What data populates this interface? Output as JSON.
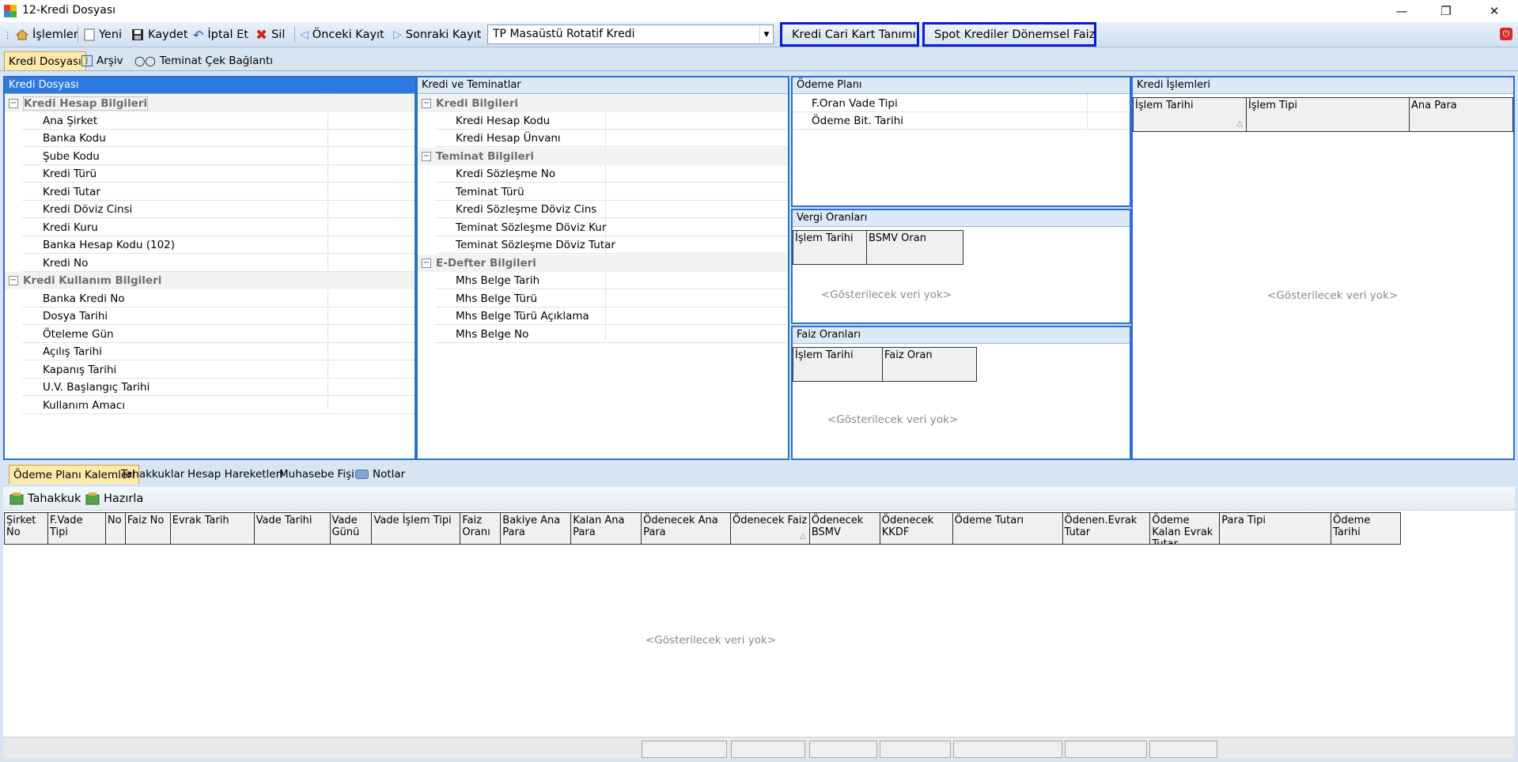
{
  "window": {
    "title": "12-Kredi Dosyası"
  },
  "toolbar": {
    "islemler": "İşlemler",
    "yeni": "Yeni",
    "kaydet": "Kaydet",
    "iptal": "İptal Et",
    "sil": "Sil",
    "onceki": "Önceki Kayıt",
    "sonraki": "Sonraki Kayıt",
    "combo_value": "TP Masaüstü Rotatif Kredi",
    "kredi_cari": "Kredi Cari Kart Tanımı",
    "spot": "Spot Krediler Dönemsel Faiz"
  },
  "tabs": [
    "Kredi Dosyası",
    "Arşiv",
    "Teminat Çek Bağlantı"
  ],
  "panels": {
    "kredi_dosyasi": {
      "title": "Kredi Dosyası",
      "group1": "Kredi Hesap Bilgileri",
      "group1_items": [
        "Ana Şirket",
        "Banka Kodu",
        "Şube Kodu",
        "Kredi Türü",
        "Kredi Tutar",
        "Kredi Döviz Cinsi",
        "Kredi Kuru",
        "Banka Hesap Kodu (102)",
        "Kredi No"
      ],
      "group2": "Kredi Kullanım Bilgileri",
      "group2_items": [
        "Banka Kredi No",
        "Dosya Tarihi",
        "Öteleme Gün",
        "Açılış Tarihi",
        "Kapanış Tarihi",
        "U.V. Başlangıç Tarihi",
        "Kullanım Amacı"
      ]
    },
    "kredi_teminat": {
      "title": "Kredi ve Teminatlar",
      "group1": "Kredi Bilgileri",
      "group1_items": [
        "Kredi Hesap Kodu",
        "Kredi Hesap Ünvanı"
      ],
      "group2": "Teminat Bilgileri",
      "group2_items": [
        "Kredi Sözleşme No",
        "Teminat Türü",
        "Kredi Sözleşme Döviz Cins",
        "Teminat Sözleşme Döviz Kur",
        "Teminat Sözleşme Döviz Tutar"
      ],
      "group3": "E-Defter Bilgileri",
      "group3_items": [
        "Mhs Belge Tarih",
        "Mhs Belge Türü",
        "Mhs Belge Türü Açıklama",
        "Mhs Belge No"
      ]
    },
    "odeme_plani": {
      "title": "Ödeme Planı",
      "items": [
        "F.Oran Vade Tipi",
        "Ödeme Bit. Tarihi"
      ]
    },
    "vergi": {
      "title": "Vergi Oranları",
      "cols": [
        "İşlem Tarihi",
        "BSMV Oran"
      ],
      "empty": "<Gösterilecek veri yok>"
    },
    "faiz": {
      "title": "Faiz Oranları",
      "cols": [
        "İşlem Tarihi",
        "Faiz Oran"
      ],
      "empty": "<Gösterilecek veri yok>"
    },
    "kredi_islemleri": {
      "title": "Kredi İşlemleri",
      "cols": [
        "İşlem Tarihi",
        "İşlem Tipi",
        "Ana Para"
      ],
      "empty": "<Gösterilecek veri yok>"
    }
  },
  "bottom_tabs": [
    "Ödeme Planı Kalemleri",
    "Tahakkuklar",
    "Hesap Hareketleri",
    "Muhasebe Fişi",
    "Notlar"
  ],
  "bottom_toolbar": {
    "tahakkuk": "Tahakkuk",
    "hazirla": "Hazırla"
  },
  "bottom_grid": {
    "cols": [
      "Şirket No",
      "F.Vade Tipi",
      "No",
      "Faiz No",
      "Evrak Tarih",
      "Vade Tarihi",
      "Vade Günü",
      "Vade İşlem Tipi",
      "Faiz Oranı",
      "Bakiye Ana Para",
      "Kalan Ana Para",
      "Ödenecek Ana Para",
      "Ödenecek Faiz",
      "Ödenecek BSMV",
      "Ödenecek KKDF",
      "Ödeme Tutarı",
      "Ödenen.Evrak Tutar",
      "Ödeme Kalan Evrak Tutar",
      "Para Tipi",
      "Ödeme Tarihi"
    ],
    "empty": "<Gösterilecek veri yok>"
  }
}
